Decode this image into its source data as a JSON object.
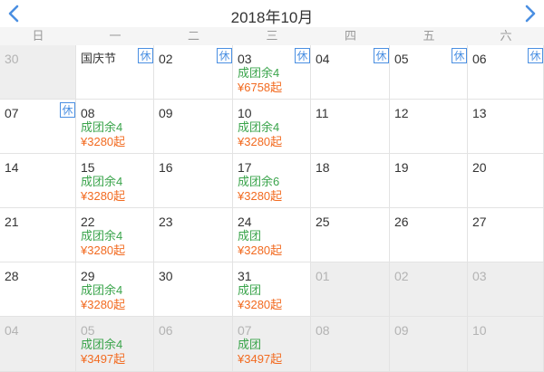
{
  "header": {
    "title": "2018年10月"
  },
  "weekdays": [
    "日",
    "一",
    "二",
    "三",
    "四",
    "五",
    "六"
  ],
  "colors": {
    "accent": "#4a8fe2",
    "availability": "#3aa44b",
    "price": "#f26b21",
    "muted": "#b3b3b3"
  },
  "icons": {
    "prev": "chevron-left-icon",
    "next": "chevron-right-icon"
  },
  "days": [
    {
      "label": "30",
      "other": true
    },
    {
      "label": "国庆节",
      "badge": "休"
    },
    {
      "label": "02",
      "badge": "休"
    },
    {
      "label": "03",
      "badge": "休",
      "info": "成团余4",
      "price": "¥6758起"
    },
    {
      "label": "04",
      "badge": "休"
    },
    {
      "label": "05",
      "badge": "休"
    },
    {
      "label": "06",
      "badge": "休"
    },
    {
      "label": "07",
      "badge": "休"
    },
    {
      "label": "08",
      "info": "成团余4",
      "price": "¥3280起"
    },
    {
      "label": "09"
    },
    {
      "label": "10",
      "info": "成团余4",
      "price": "¥3280起"
    },
    {
      "label": "11"
    },
    {
      "label": "12"
    },
    {
      "label": "13"
    },
    {
      "label": "14"
    },
    {
      "label": "15",
      "info": "成团余4",
      "price": "¥3280起"
    },
    {
      "label": "16"
    },
    {
      "label": "17",
      "info": "成团余6",
      "price": "¥3280起"
    },
    {
      "label": "18"
    },
    {
      "label": "19"
    },
    {
      "label": "20"
    },
    {
      "label": "21"
    },
    {
      "label": "22",
      "info": "成团余4",
      "price": "¥3280起"
    },
    {
      "label": "23"
    },
    {
      "label": "24",
      "info": "成团",
      "price": "¥3280起"
    },
    {
      "label": "25"
    },
    {
      "label": "26"
    },
    {
      "label": "27"
    },
    {
      "label": "28"
    },
    {
      "label": "29",
      "info": "成团余4",
      "price": "¥3280起"
    },
    {
      "label": "30"
    },
    {
      "label": "31",
      "info": "成团",
      "price": "¥3280起"
    },
    {
      "label": "01",
      "other": true
    },
    {
      "label": "02",
      "other": true
    },
    {
      "label": "03",
      "other": true
    },
    {
      "label": "04",
      "other": true
    },
    {
      "label": "05",
      "other": true,
      "info": "成团余4",
      "price": "¥3497起"
    },
    {
      "label": "06",
      "other": true
    },
    {
      "label": "07",
      "other": true,
      "info": "成团",
      "price": "¥3497起"
    },
    {
      "label": "08",
      "other": true
    },
    {
      "label": "09",
      "other": true
    },
    {
      "label": "10",
      "other": true
    }
  ]
}
